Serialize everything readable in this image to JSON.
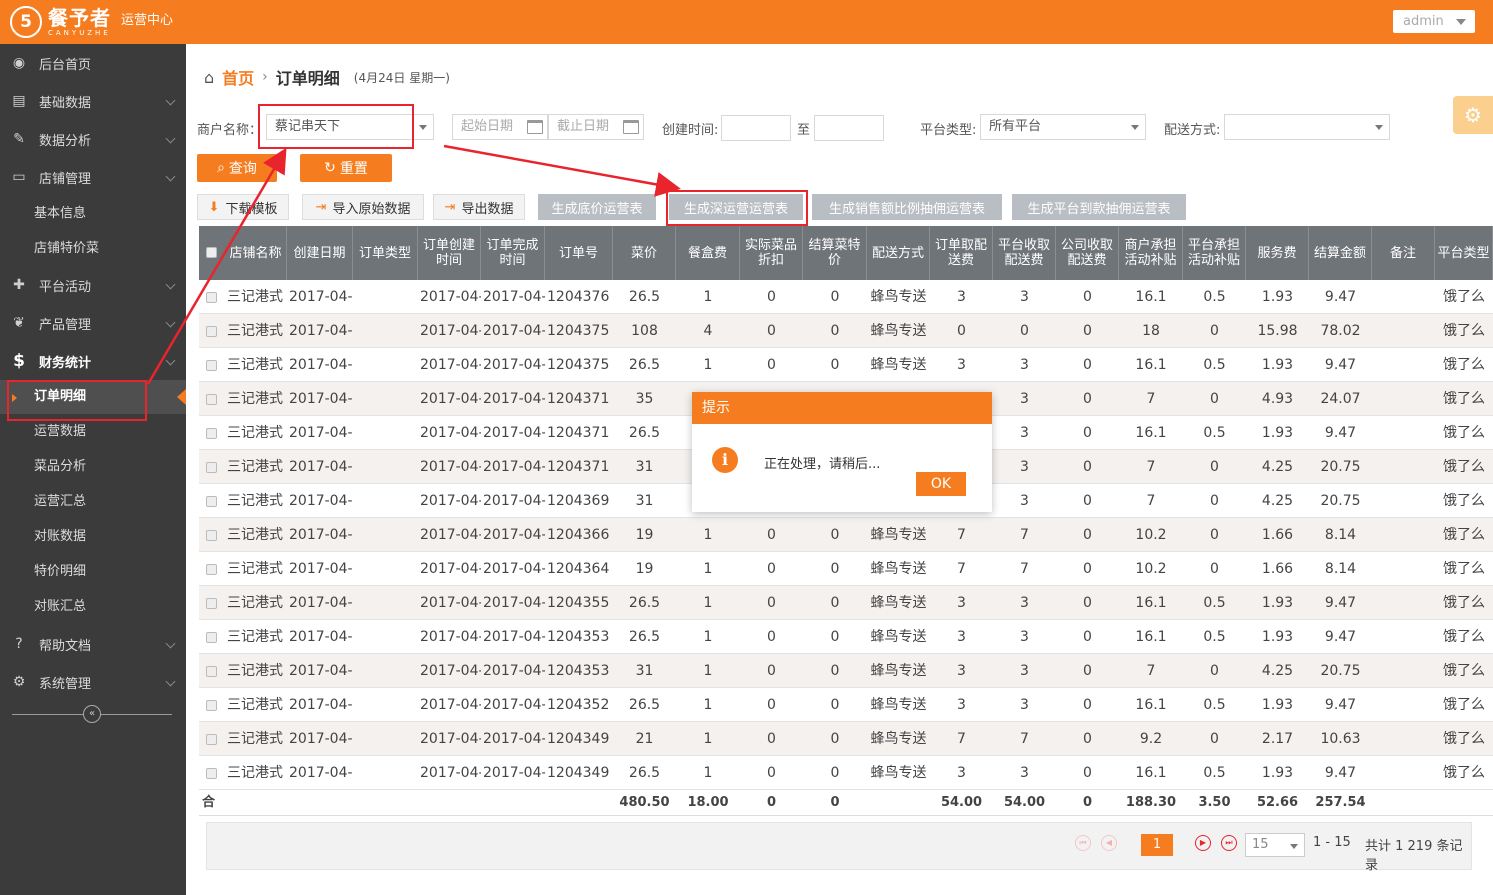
{
  "header": {
    "logo_mark": "5",
    "logo_cn": "餐予者",
    "logo_en": "CANYUZHE",
    "subtitle": "运营中心",
    "user": "admin"
  },
  "sidebar": {
    "items": [
      {
        "label": "后台首页",
        "icon": "dashboard-icon"
      },
      {
        "label": "基础数据",
        "icon": "book-icon"
      },
      {
        "label": "数据分析",
        "icon": "wand-icon"
      },
      {
        "label": "店铺管理",
        "icon": "inbox-icon"
      },
      {
        "label": "平台活动",
        "icon": "gift-icon"
      },
      {
        "label": "产品管理",
        "icon": "leaf-icon"
      },
      {
        "label": "财务统计",
        "icon": "dollar-icon"
      },
      {
        "label": "帮助文档",
        "icon": "question-icon"
      },
      {
        "label": "系统管理",
        "icon": "cogs-icon"
      }
    ],
    "store_sub": [
      "基本信息",
      "店铺特价菜"
    ],
    "finance_sub": [
      "订单明细",
      "运营数据",
      "菜品分析",
      "运营汇总",
      "对账数据",
      "特价明细",
      "对账汇总"
    ],
    "collapse": "«"
  },
  "breadcrumb": {
    "home": "首页",
    "sep": "›",
    "current": "订单明细",
    "date": "(4月24日 星期一)"
  },
  "filters": {
    "merchant_label": "商户名称：",
    "merchant_value": "蔡记串天下",
    "start_date": "起始日期",
    "end_date": "截止日期",
    "created_label": "创建时间:",
    "to": "至",
    "platform_label": "平台类型:",
    "platform_value": "所有平台",
    "delivery_label": "配送方式:",
    "query": "查询",
    "reset": "重置"
  },
  "toolbar": {
    "download_template": "下载模板",
    "import": "导入原始数据",
    "export": "导出数据",
    "gen_base": "生成底价运营表",
    "gen_deep": "生成深运营运营表",
    "gen_sales": "生成销售额比例抽佣运营表",
    "gen_platform": "生成平台到款抽佣运营表"
  },
  "table": {
    "headers": [
      "店铺名称",
      "创建日期",
      "订单类型",
      "订单创建时间",
      "订单完成时间",
      "订单号",
      "菜价",
      "餐盒费",
      "实际菜品折扣",
      "结算菜特价",
      "配送方式",
      "订单取配送费",
      "平台收取配送费",
      "公司收取配送费",
      "商户承担活动补贴",
      "平台承担活动补贴",
      "服务费",
      "结算金额",
      "备注",
      "平台类型"
    ],
    "rows": [
      [
        "三记港式",
        "2017-04-",
        "",
        "2017-04-",
        "2017-04-",
        "1204376",
        "26.5",
        "1",
        "0",
        "0",
        "蜂鸟专送",
        "3",
        "3",
        "0",
        "16.1",
        "0.5",
        "1.93",
        "9.47",
        "",
        "饿了么"
      ],
      [
        "三记港式",
        "2017-04-",
        "",
        "2017-04-",
        "2017-04-",
        "1204375",
        "108",
        "4",
        "0",
        "0",
        "蜂鸟专送",
        "0",
        "0",
        "0",
        "18",
        "0",
        "15.98",
        "78.02",
        "",
        "饿了么"
      ],
      [
        "三记港式",
        "2017-04-",
        "",
        "2017-04-",
        "2017-04-",
        "1204375",
        "26.5",
        "1",
        "0",
        "0",
        "蜂鸟专送",
        "3",
        "3",
        "0",
        "16.1",
        "0.5",
        "1.93",
        "9.47",
        "",
        "饿了么"
      ],
      [
        "三记港式",
        "2017-04-",
        "",
        "2017-04-",
        "2017-04-",
        "1204371",
        "35",
        "",
        "",
        "",
        "",
        "",
        "3",
        "0",
        "7",
        "0",
        "4.93",
        "24.07",
        "",
        "饿了么"
      ],
      [
        "三记港式",
        "2017-04-",
        "",
        "2017-04-",
        "2017-04-",
        "1204371",
        "26.5",
        "",
        "",
        "",
        "",
        "",
        "3",
        "0",
        "16.1",
        "0.5",
        "1.93",
        "9.47",
        "",
        "饿了么"
      ],
      [
        "三记港式",
        "2017-04-",
        "",
        "2017-04-",
        "2017-04-",
        "1204371",
        "31",
        "",
        "",
        "",
        "",
        "",
        "3",
        "0",
        "7",
        "0",
        "4.25",
        "20.75",
        "",
        "饿了么"
      ],
      [
        "三记港式",
        "2017-04-",
        "",
        "2017-04-",
        "2017-04-",
        "1204369",
        "31",
        "",
        "",
        "",
        "",
        "",
        "3",
        "0",
        "7",
        "0",
        "4.25",
        "20.75",
        "",
        "饿了么"
      ],
      [
        "三记港式",
        "2017-04-",
        "",
        "2017-04-",
        "2017-04-",
        "1204366",
        "19",
        "1",
        "0",
        "0",
        "蜂鸟专送",
        "7",
        "7",
        "0",
        "10.2",
        "0",
        "1.66",
        "8.14",
        "",
        "饿了么"
      ],
      [
        "三记港式",
        "2017-04-",
        "",
        "2017-04-",
        "2017-04-",
        "1204364",
        "19",
        "1",
        "0",
        "0",
        "蜂鸟专送",
        "7",
        "7",
        "0",
        "10.2",
        "0",
        "1.66",
        "8.14",
        "",
        "饿了么"
      ],
      [
        "三记港式",
        "2017-04-",
        "",
        "2017-04-",
        "2017-04-",
        "1204355",
        "26.5",
        "1",
        "0",
        "0",
        "蜂鸟专送",
        "3",
        "3",
        "0",
        "16.1",
        "0.5",
        "1.93",
        "9.47",
        "",
        "饿了么"
      ],
      [
        "三记港式",
        "2017-04-",
        "",
        "2017-04-",
        "2017-04-",
        "1204353",
        "26.5",
        "1",
        "0",
        "0",
        "蜂鸟专送",
        "3",
        "3",
        "0",
        "16.1",
        "0.5",
        "1.93",
        "9.47",
        "",
        "饿了么"
      ],
      [
        "三记港式",
        "2017-04-",
        "",
        "2017-04-",
        "2017-04-",
        "1204353",
        "31",
        "1",
        "0",
        "0",
        "蜂鸟专送",
        "3",
        "3",
        "0",
        "7",
        "0",
        "4.25",
        "20.75",
        "",
        "饿了么"
      ],
      [
        "三记港式",
        "2017-04-",
        "",
        "2017-04-",
        "2017-04-",
        "1204352",
        "26.5",
        "1",
        "0",
        "0",
        "蜂鸟专送",
        "3",
        "3",
        "0",
        "16.1",
        "0.5",
        "1.93",
        "9.47",
        "",
        "饿了么"
      ],
      [
        "三记港式",
        "2017-04-",
        "",
        "2017-04-",
        "2017-04-",
        "1204349",
        "21",
        "1",
        "0",
        "0",
        "蜂鸟专送",
        "7",
        "7",
        "0",
        "9.2",
        "0",
        "2.17",
        "10.63",
        "",
        "饿了么"
      ],
      [
        "三记港式",
        "2017-04-",
        "",
        "2017-04-",
        "2017-04-",
        "1204349",
        "26.5",
        "1",
        "0",
        "0",
        "蜂鸟专送",
        "3",
        "3",
        "0",
        "16.1",
        "0.5",
        "1.93",
        "9.47",
        "",
        "饿了么"
      ]
    ],
    "summary": [
      "合",
      "",
      "",
      "",
      "",
      "",
      "480.50",
      "18.00",
      "0",
      "0",
      "",
      "54.00",
      "54.00",
      "0",
      "188.30",
      "3.50",
      "52.66",
      "257.54",
      "",
      ""
    ]
  },
  "pager": {
    "current_page": "1",
    "page_size": "15",
    "range": "1 - 15",
    "total": "共计 1 219 条记录"
  },
  "dialog": {
    "title": "提示",
    "icon": "i",
    "message": "正在处理，请稍后...",
    "ok": "OK"
  },
  "colors": {
    "brand": "#f57d1f",
    "sidebar": "#3b3b3b",
    "header_row": "#6f7479",
    "highlight": "#e8242c"
  }
}
